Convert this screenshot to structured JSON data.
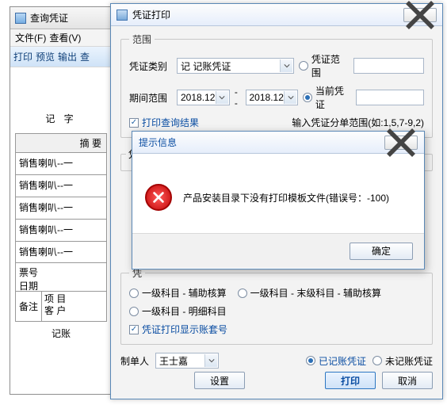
{
  "bg": {
    "title": "查询凭证",
    "menu_file": "文件(F)",
    "menu_view": "查看(V)",
    "tool_print": "打印",
    "tool_preview": "预览",
    "tool_export": "输出",
    "tool_more": "查",
    "subtitle": "记   字",
    "tbl_header": "摘  要",
    "row_text": "销售喇叭--一",
    "foot_bill": "票号",
    "foot_date": "日期",
    "remark_label": "备注",
    "remark_c1a": "项  目",
    "remark_c1b": "客  户",
    "bottom": "记账"
  },
  "dlg": {
    "title": "凭证打印",
    "range_legend": "范围",
    "voucher_type_label": "凭证类别",
    "voucher_type_value": "记 记账凭证",
    "period_label": "期间范围",
    "period_from": "2018.12",
    "period_to": "2018.12",
    "radio_range": "凭证范围",
    "radio_current": "当前凭证",
    "check_print_result": "打印查询结果",
    "hint_text": "输入凭证分单范围(如:1,5,7-9,2)",
    "format_legend": "凭证格式",
    "stub_legend": "凭",
    "opt1": "一级科目 - 辅助核算",
    "opt2": "一级科目 - 末级科目 - 辅助核算",
    "opt3": "一级科目 - 明细科目",
    "check_show_set": "凭证打印显示账套号",
    "maker_label": "制单人",
    "maker_value": "王士嘉",
    "radio_posted": "已记账凭证",
    "radio_unposted": "未记账凭证",
    "btn_settings": "设置",
    "btn_print": "打印",
    "btn_cancel": "取消"
  },
  "modal": {
    "title": "提示信息",
    "message": "产品安装目录下没有打印模板文件(错误号：-100)",
    "ok": "确定"
  }
}
